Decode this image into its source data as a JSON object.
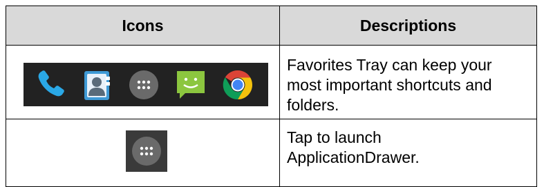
{
  "table": {
    "headers": {
      "icons": "Icons",
      "descriptions": "Descriptions"
    },
    "rows": [
      {
        "icons": [
          "phone-icon",
          "contacts-icon",
          "app-drawer-icon",
          "messaging-icon",
          "chrome-icon"
        ],
        "description": "Favorites Tray can keep your\nmost important shortcuts and\nfolders."
      },
      {
        "icons": [
          "app-drawer-icon"
        ],
        "description": "Tap to launch\nApplicationDrawer."
      }
    ]
  },
  "colors": {
    "header_background": "#d9d9d9",
    "tray_background": "#222222",
    "phone": "#2aa8e6",
    "contacts": "#3f9ad6",
    "drawer": "#6a6a6a",
    "messaging": "#8cc63f",
    "chrome_red": "#db4437",
    "chrome_yellow": "#f4c20d",
    "chrome_green": "#0f9d58",
    "chrome_blue": "#4285f4"
  }
}
